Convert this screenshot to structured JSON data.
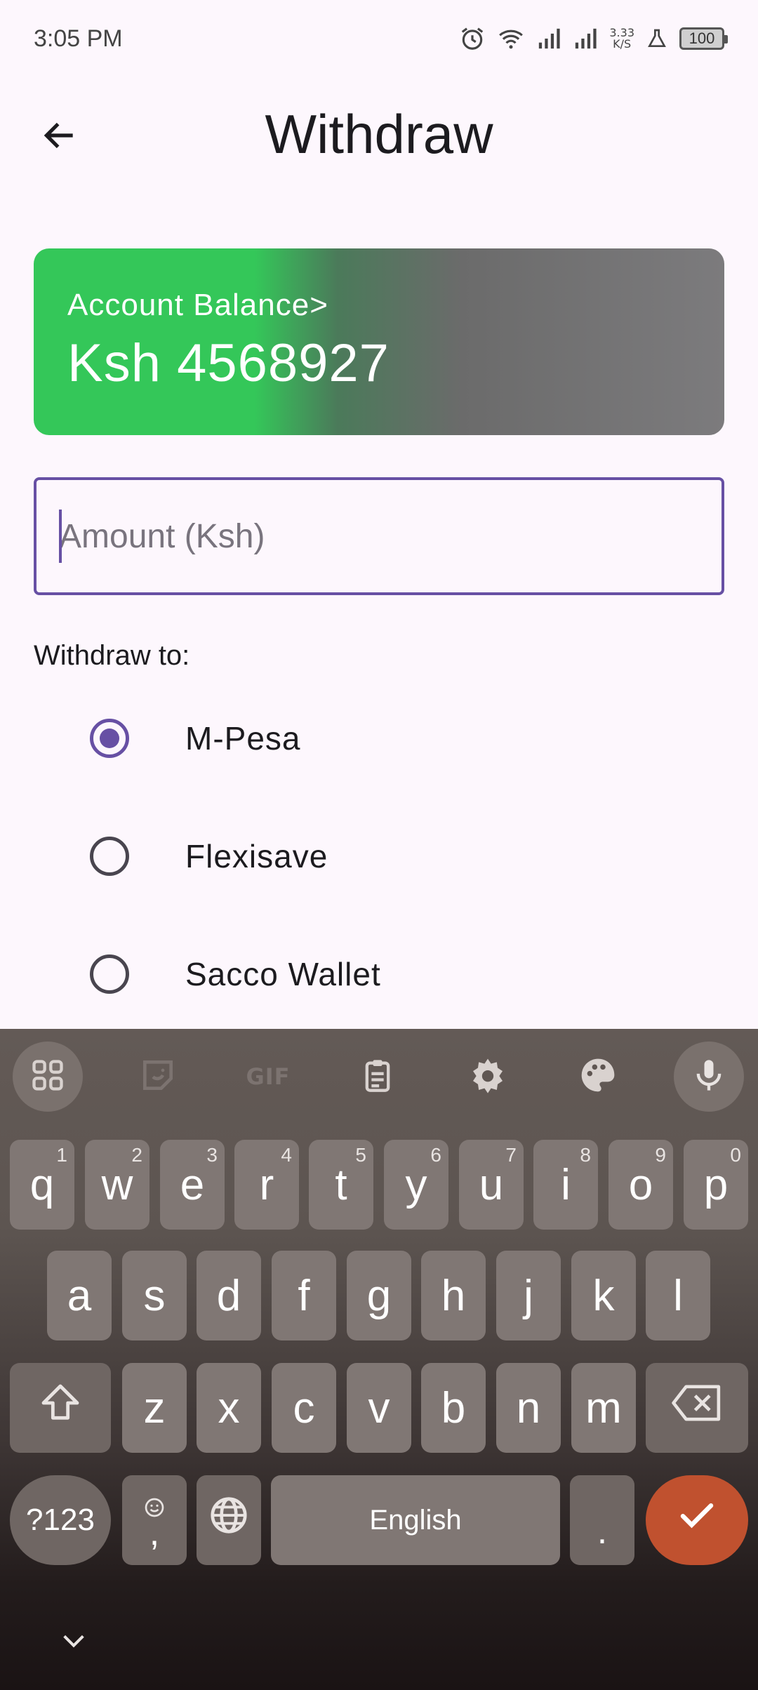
{
  "status": {
    "time": "3:05 PM",
    "net_speed_value": "3.33",
    "net_speed_unit": "K/S",
    "battery": "100",
    "icons": [
      "alarm-icon",
      "wifi-icon",
      "signal-icon",
      "signal-icon",
      "flask-icon",
      "battery-icon"
    ]
  },
  "header": {
    "title": "Withdraw",
    "back_icon": "arrow-left-icon"
  },
  "balance": {
    "label": "Account Balance>",
    "value": "Ksh 4568927"
  },
  "amount": {
    "placeholder": "Amount (Ksh)",
    "value": ""
  },
  "withdraw_to": {
    "label": "Withdraw to:",
    "options": [
      {
        "label": "M-Pesa",
        "selected": true
      },
      {
        "label": "Flexisave",
        "selected": false
      },
      {
        "label": "Sacco Wallet",
        "selected": false
      }
    ]
  },
  "keyboard": {
    "toolbar": [
      "apps-icon",
      "sticker-icon",
      "GIF",
      "clipboard-icon",
      "settings-icon",
      "palette-icon",
      "mic-icon"
    ],
    "row1": [
      {
        "k": "q",
        "h": "1"
      },
      {
        "k": "w",
        "h": "2"
      },
      {
        "k": "e",
        "h": "3"
      },
      {
        "k": "r",
        "h": "4"
      },
      {
        "k": "t",
        "h": "5"
      },
      {
        "k": "y",
        "h": "6"
      },
      {
        "k": "u",
        "h": "7"
      },
      {
        "k": "i",
        "h": "8"
      },
      {
        "k": "o",
        "h": "9"
      },
      {
        "k": "p",
        "h": "0"
      }
    ],
    "row2": [
      "a",
      "s",
      "d",
      "f",
      "g",
      "h",
      "j",
      "k",
      "l"
    ],
    "row3": [
      "z",
      "x",
      "c",
      "v",
      "b",
      "n",
      "m"
    ],
    "symbols_label": "?123",
    "comma": ",",
    "space_label": "English",
    "period": ".",
    "colors": {
      "enter": "#c0512f",
      "accent": "#6750a4",
      "balance_green": "#34c759"
    }
  }
}
